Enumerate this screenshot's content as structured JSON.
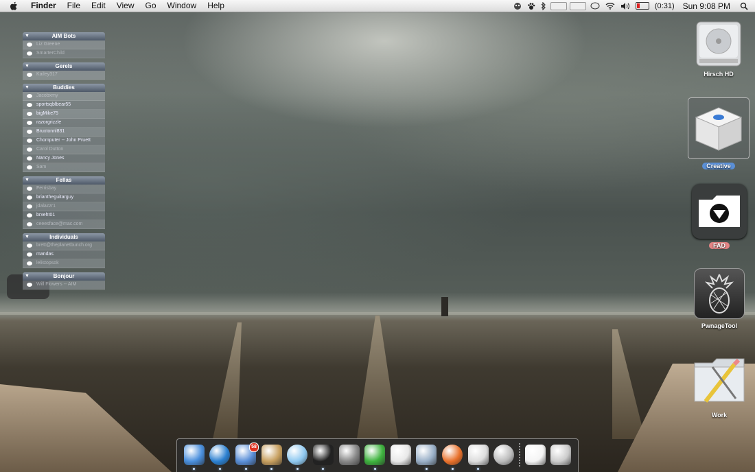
{
  "menubar": {
    "app_name": "Finder",
    "menus": [
      "File",
      "Edit",
      "View",
      "Go",
      "Window",
      "Help"
    ],
    "battery_text": "(0:31)",
    "clock": "Sun 9:08 PM",
    "extras_icons": [
      "robot-icon",
      "paw-icon",
      "bluetooth-icon",
      "slot-1",
      "slot-2",
      "chat-bubble-icon",
      "wifi-icon",
      "volume-icon",
      "battery-icon",
      "spotlight-icon"
    ]
  },
  "buddylist": {
    "groups": [
      {
        "name": "AIM Bots",
        "buddies": [
          {
            "name": "Liz Greene",
            "idle": true
          },
          {
            "name": "SmarterChild",
            "idle": true
          }
        ]
      },
      {
        "name": "Gerels",
        "buddies": [
          {
            "name": "Kailey317",
            "idle": true
          }
        ]
      },
      {
        "name": "Buddies",
        "buddies": [
          {
            "name": "Jacobxmy",
            "idle": true
          },
          {
            "name": "sportsqblbear55",
            "idle": false
          },
          {
            "name": "bigMike75",
            "idle": false
          },
          {
            "name": "razorgrizzle",
            "idle": false
          },
          {
            "name": "Bruxtonnl831",
            "idle": false
          },
          {
            "name": "Chomputer -- John Pruett",
            "idle": false
          },
          {
            "name": "Carol Dutton",
            "idle": true
          },
          {
            "name": "Nancy Jones",
            "idle": false
          },
          {
            "name": "Sam",
            "idle": true
          }
        ]
      },
      {
        "name": "Fellas",
        "buddies": [
          {
            "name": "Ferrisbay",
            "idle": true
          },
          {
            "name": "briantheguitarguy",
            "idle": false
          },
          {
            "name": "jdalazzr1",
            "idle": true
          },
          {
            "name": "brxeht01",
            "idle": false
          },
          {
            "name": "ceeesface@mac.com",
            "idle": true
          }
        ]
      },
      {
        "name": "Individuals",
        "buddies": [
          {
            "name": "brett@theplanetbunch.org",
            "idle": true
          },
          {
            "name": "mandas",
            "idle": false
          },
          {
            "name": "lelistopsok",
            "idle": true
          }
        ]
      },
      {
        "name": "Bonjour",
        "buddies": [
          {
            "name": "Will Flowers -- AIM",
            "idle": true
          }
        ]
      }
    ]
  },
  "desktop_icons": [
    {
      "label": "Hirsch HD",
      "icon": "hard-drive-icon"
    },
    {
      "label": "Creative",
      "icon": "installer-box-icon",
      "selected": true,
      "label_color": "#6aa0e0"
    },
    {
      "label": "FAD",
      "icon": "folder-download-icon",
      "label_color": "#e88a8a"
    },
    {
      "label": "PwnageTool",
      "icon": "pineapple-icon"
    },
    {
      "label": "Work",
      "icon": "work-folder-icon"
    }
  ],
  "dock": {
    "items": [
      {
        "name": "finder-icon",
        "running": true,
        "color": "#4a8fdd"
      },
      {
        "name": "safari-icon",
        "running": true,
        "color": "#2a7fd0"
      },
      {
        "name": "mail-icon",
        "running": true,
        "color": "#5a8fd8",
        "badge": "58"
      },
      {
        "name": "address-book-icon",
        "running": true,
        "color": "#c8a060"
      },
      {
        "name": "itunes-icon",
        "running": true,
        "color": "#8ec8f0"
      },
      {
        "name": "terminal-icon",
        "running": true,
        "color": "#222222"
      },
      {
        "name": "system-preferences-icon",
        "running": false,
        "color": "#888888"
      },
      {
        "name": "leaf-icon",
        "running": true,
        "color": "#3fb33f"
      },
      {
        "name": "textedit-icon",
        "running": false,
        "color": "#e8e8e8"
      },
      {
        "name": "preview-icon",
        "running": true,
        "color": "#9ab0c8"
      },
      {
        "name": "firefox-icon",
        "running": true,
        "color": "#e8702a"
      },
      {
        "name": "document-icon",
        "running": true,
        "color": "#dddddd"
      },
      {
        "name": "camera-icon",
        "running": false,
        "color": "#bbbbbb"
      },
      {
        "name": "separator",
        "running": false
      },
      {
        "name": "installer-box-icon",
        "running": false,
        "color": "#f4f4f4"
      },
      {
        "name": "trash-icon",
        "running": false,
        "color": "#cccccc"
      }
    ]
  }
}
